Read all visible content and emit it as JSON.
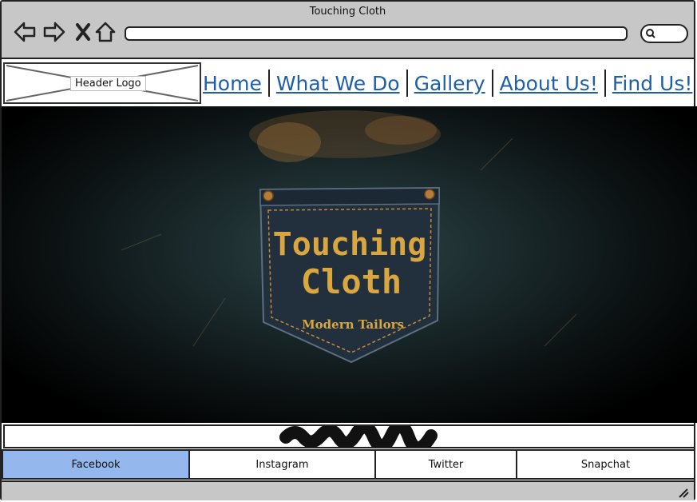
{
  "window": {
    "title": "Touching Cloth"
  },
  "browser": {
    "url": "",
    "icons": [
      "back-arrow-icon",
      "forward-arrow-icon",
      "close-icon",
      "home-icon",
      "search-icon"
    ]
  },
  "header": {
    "logo_label": "Header Logo",
    "menu": [
      {
        "label": "Home"
      },
      {
        "label": "What We Do"
      },
      {
        "label": "Gallery"
      },
      {
        "label": "About Us!"
      },
      {
        "label": "Find Us!"
      }
    ]
  },
  "hero": {
    "brand_line1": "Touching",
    "brand_line2": "Cloth",
    "tagline": "Modern Tailors"
  },
  "social": {
    "tabs": [
      {
        "label": "Facebook",
        "active": true
      },
      {
        "label": "Instagram",
        "active": false
      },
      {
        "label": "Twitter",
        "active": false
      },
      {
        "label": "Snapchat",
        "active": false
      }
    ]
  },
  "colors": {
    "link": "#1f5fa8",
    "active_tab": "#94b8ed",
    "chrome": "#c7c7c7",
    "brand_gold": "#d9a640"
  }
}
